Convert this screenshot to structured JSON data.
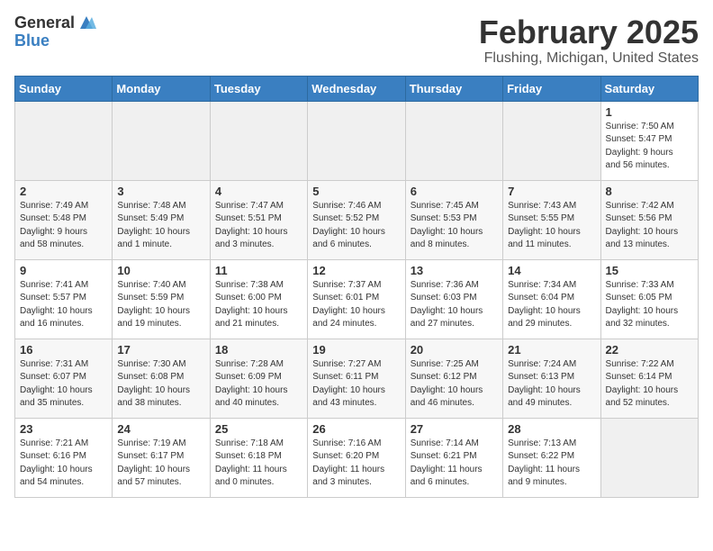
{
  "logo": {
    "general": "General",
    "blue": "Blue"
  },
  "header": {
    "month": "February 2025",
    "location": "Flushing, Michigan, United States"
  },
  "weekdays": [
    "Sunday",
    "Monday",
    "Tuesday",
    "Wednesday",
    "Thursday",
    "Friday",
    "Saturday"
  ],
  "weeks": [
    [
      {
        "day": "",
        "info": ""
      },
      {
        "day": "",
        "info": ""
      },
      {
        "day": "",
        "info": ""
      },
      {
        "day": "",
        "info": ""
      },
      {
        "day": "",
        "info": ""
      },
      {
        "day": "",
        "info": ""
      },
      {
        "day": "1",
        "info": "Sunrise: 7:50 AM\nSunset: 5:47 PM\nDaylight: 9 hours\nand 56 minutes."
      }
    ],
    [
      {
        "day": "2",
        "info": "Sunrise: 7:49 AM\nSunset: 5:48 PM\nDaylight: 9 hours\nand 58 minutes."
      },
      {
        "day": "3",
        "info": "Sunrise: 7:48 AM\nSunset: 5:49 PM\nDaylight: 10 hours\nand 1 minute."
      },
      {
        "day": "4",
        "info": "Sunrise: 7:47 AM\nSunset: 5:51 PM\nDaylight: 10 hours\nand 3 minutes."
      },
      {
        "day": "5",
        "info": "Sunrise: 7:46 AM\nSunset: 5:52 PM\nDaylight: 10 hours\nand 6 minutes."
      },
      {
        "day": "6",
        "info": "Sunrise: 7:45 AM\nSunset: 5:53 PM\nDaylight: 10 hours\nand 8 minutes."
      },
      {
        "day": "7",
        "info": "Sunrise: 7:43 AM\nSunset: 5:55 PM\nDaylight: 10 hours\nand 11 minutes."
      },
      {
        "day": "8",
        "info": "Sunrise: 7:42 AM\nSunset: 5:56 PM\nDaylight: 10 hours\nand 13 minutes."
      }
    ],
    [
      {
        "day": "9",
        "info": "Sunrise: 7:41 AM\nSunset: 5:57 PM\nDaylight: 10 hours\nand 16 minutes."
      },
      {
        "day": "10",
        "info": "Sunrise: 7:40 AM\nSunset: 5:59 PM\nDaylight: 10 hours\nand 19 minutes."
      },
      {
        "day": "11",
        "info": "Sunrise: 7:38 AM\nSunset: 6:00 PM\nDaylight: 10 hours\nand 21 minutes."
      },
      {
        "day": "12",
        "info": "Sunrise: 7:37 AM\nSunset: 6:01 PM\nDaylight: 10 hours\nand 24 minutes."
      },
      {
        "day": "13",
        "info": "Sunrise: 7:36 AM\nSunset: 6:03 PM\nDaylight: 10 hours\nand 27 minutes."
      },
      {
        "day": "14",
        "info": "Sunrise: 7:34 AM\nSunset: 6:04 PM\nDaylight: 10 hours\nand 29 minutes."
      },
      {
        "day": "15",
        "info": "Sunrise: 7:33 AM\nSunset: 6:05 PM\nDaylight: 10 hours\nand 32 minutes."
      }
    ],
    [
      {
        "day": "16",
        "info": "Sunrise: 7:31 AM\nSunset: 6:07 PM\nDaylight: 10 hours\nand 35 minutes."
      },
      {
        "day": "17",
        "info": "Sunrise: 7:30 AM\nSunset: 6:08 PM\nDaylight: 10 hours\nand 38 minutes."
      },
      {
        "day": "18",
        "info": "Sunrise: 7:28 AM\nSunset: 6:09 PM\nDaylight: 10 hours\nand 40 minutes."
      },
      {
        "day": "19",
        "info": "Sunrise: 7:27 AM\nSunset: 6:11 PM\nDaylight: 10 hours\nand 43 minutes."
      },
      {
        "day": "20",
        "info": "Sunrise: 7:25 AM\nSunset: 6:12 PM\nDaylight: 10 hours\nand 46 minutes."
      },
      {
        "day": "21",
        "info": "Sunrise: 7:24 AM\nSunset: 6:13 PM\nDaylight: 10 hours\nand 49 minutes."
      },
      {
        "day": "22",
        "info": "Sunrise: 7:22 AM\nSunset: 6:14 PM\nDaylight: 10 hours\nand 52 minutes."
      }
    ],
    [
      {
        "day": "23",
        "info": "Sunrise: 7:21 AM\nSunset: 6:16 PM\nDaylight: 10 hours\nand 54 minutes."
      },
      {
        "day": "24",
        "info": "Sunrise: 7:19 AM\nSunset: 6:17 PM\nDaylight: 10 hours\nand 57 minutes."
      },
      {
        "day": "25",
        "info": "Sunrise: 7:18 AM\nSunset: 6:18 PM\nDaylight: 11 hours\nand 0 minutes."
      },
      {
        "day": "26",
        "info": "Sunrise: 7:16 AM\nSunset: 6:20 PM\nDaylight: 11 hours\nand 3 minutes."
      },
      {
        "day": "27",
        "info": "Sunrise: 7:14 AM\nSunset: 6:21 PM\nDaylight: 11 hours\nand 6 minutes."
      },
      {
        "day": "28",
        "info": "Sunrise: 7:13 AM\nSunset: 6:22 PM\nDaylight: 11 hours\nand 9 minutes."
      },
      {
        "day": "",
        "info": ""
      }
    ]
  ]
}
